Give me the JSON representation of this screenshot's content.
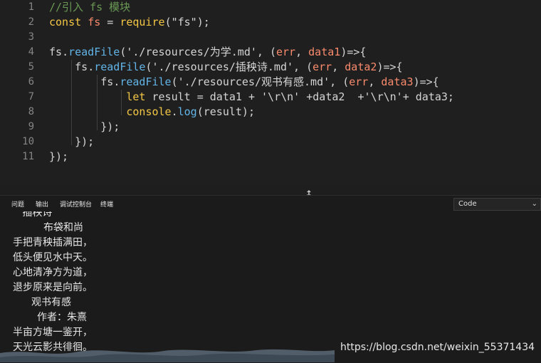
{
  "editor": {
    "lines": [
      {
        "n": "1",
        "parts": [
          {
            "t": "//引入 fs 模块",
            "c": "c-comment"
          }
        ]
      },
      {
        "n": "2",
        "parts": [
          {
            "t": "const",
            "c": "c-kw"
          },
          {
            "t": " ",
            "c": "c-light"
          },
          {
            "t": "fs",
            "c": "c-var"
          },
          {
            "t": " = ",
            "c": "c-light"
          },
          {
            "t": "require",
            "c": "c-kw"
          },
          {
            "t": "(\"fs\");",
            "c": "c-light"
          }
        ]
      },
      {
        "n": "3",
        "parts": []
      },
      {
        "n": "4",
        "parts": [
          {
            "t": "fs",
            "c": "c-light"
          },
          {
            "t": ".",
            "c": "c-light"
          },
          {
            "t": "readFile",
            "c": "c-fn"
          },
          {
            "t": "('./resources/为学.md', (",
            "c": "c-light"
          },
          {
            "t": "err",
            "c": "c-param"
          },
          {
            "t": ", ",
            "c": "c-light"
          },
          {
            "t": "data1",
            "c": "c-param"
          },
          {
            "t": ")=>{",
            "c": "c-light"
          }
        ]
      },
      {
        "n": "5",
        "parts": [
          {
            "t": "    fs",
            "c": "c-light"
          },
          {
            "t": ".",
            "c": "c-light"
          },
          {
            "t": "readFile",
            "c": "c-fn"
          },
          {
            "t": "('./resources/插秧诗.md', (",
            "c": "c-light"
          },
          {
            "t": "err",
            "c": "c-param"
          },
          {
            "t": ", ",
            "c": "c-light"
          },
          {
            "t": "data2",
            "c": "c-param"
          },
          {
            "t": ")=>{",
            "c": "c-light"
          }
        ]
      },
      {
        "n": "6",
        "parts": [
          {
            "t": "        fs",
            "c": "c-light"
          },
          {
            "t": ".",
            "c": "c-light"
          },
          {
            "t": "readFile",
            "c": "c-fn"
          },
          {
            "t": "('./resources/观书有感.md', (",
            "c": "c-light"
          },
          {
            "t": "err",
            "c": "c-param"
          },
          {
            "t": ", ",
            "c": "c-light"
          },
          {
            "t": "data3",
            "c": "c-param"
          },
          {
            "t": ")=>{",
            "c": "c-light"
          }
        ]
      },
      {
        "n": "7",
        "parts": [
          {
            "t": "            ",
            "c": "c-light"
          },
          {
            "t": "let",
            "c": "c-kw"
          },
          {
            "t": " result = data1 + '\\r\\n' +data2  +'\\r\\n'+ data3;",
            "c": "c-light"
          }
        ]
      },
      {
        "n": "8",
        "parts": [
          {
            "t": "            ",
            "c": "c-light"
          },
          {
            "t": "console",
            "c": "c-kw"
          },
          {
            "t": ".",
            "c": "c-light"
          },
          {
            "t": "log",
            "c": "c-fn"
          },
          {
            "t": "(result);",
            "c": "c-light"
          }
        ]
      },
      {
        "n": "9",
        "parts": [
          {
            "t": "        });",
            "c": "c-light"
          }
        ]
      },
      {
        "n": "10",
        "parts": [
          {
            "t": "    });",
            "c": "c-light"
          }
        ]
      },
      {
        "n": "11",
        "parts": [
          {
            "t": "});",
            "c": "c-light"
          }
        ]
      }
    ]
  },
  "panel": {
    "tabs": [
      "问题",
      "输出",
      "调试控制台",
      "终端"
    ],
    "select_value": "Code",
    "output_lines": [
      {
        "t": "   插秧诗",
        "x": 18
      },
      {
        "t": "布袋和尚",
        "x": 61
      },
      {
        "t": "手把青秧插满田，",
        "x": 18
      },
      {
        "t": "低头便见水中天。",
        "x": 18
      },
      {
        "t": "心地清净方为道，",
        "x": 18
      },
      {
        "t": "退步原来是向前。",
        "x": 18
      },
      {
        "t": "观书有感",
        "x": 44
      },
      {
        "t": "作者：朱熹",
        "x": 52
      },
      {
        "t": "半亩方塘一鉴开，",
        "x": 18
      },
      {
        "t": "天光云影共徘徊。",
        "x": 18
      }
    ]
  },
  "watermark": "https://blog.csdn.net/weixin_55371434"
}
